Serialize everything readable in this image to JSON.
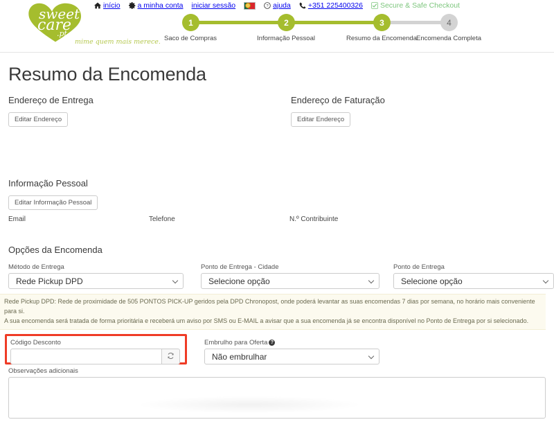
{
  "topbar": {
    "items": [
      {
        "label": "início",
        "icon": "home-icon"
      },
      {
        "label": "a minha conta",
        "icon": "gear-icon"
      },
      {
        "label": "iniciar sessão",
        "icon": "none"
      },
      {
        "label": "",
        "icon": "portugal-flag-icon"
      },
      {
        "label": "ajuda",
        "icon": "question-circle-icon"
      },
      {
        "label": "+351 225400326",
        "icon": "phone-icon"
      },
      {
        "label": "Secure & Safe Checkout",
        "icon": "check-square-icon"
      }
    ],
    "secure_color": "#7dc67d"
  },
  "logo": {
    "line1": "sweet",
    "line2": "care",
    "line3": ".pt",
    "tagline": "mime quem mais merece.",
    "heart_color": "#a5bd2e",
    "tagline_color": "#b5c84f"
  },
  "stepper": {
    "active_color": "#a5bd2e",
    "inactive_color": "#d3d3d3",
    "steps": [
      {
        "number": "1",
        "label": "Saco de Compras",
        "active": true
      },
      {
        "number": "2",
        "label": "Informação Pessoal",
        "active": true
      },
      {
        "number": "3",
        "label": "Resumo da Encomenda",
        "active": true
      },
      {
        "number": "4",
        "label": "Encomenda Completa",
        "active": false
      }
    ]
  },
  "page": {
    "title": "Resumo da Encomenda"
  },
  "shipping_address": {
    "heading": "Endereço de Entrega",
    "edit_label": "Editar Endereço"
  },
  "billing_address": {
    "heading": "Endereço de Faturação",
    "edit_label": "Editar Endereço"
  },
  "personal_info": {
    "heading": "Informação Pessoal",
    "edit_label": "Editar Informação Pessoal",
    "fields": [
      {
        "label": "Email",
        "value": ""
      },
      {
        "label": "Telefone",
        "value": ""
      },
      {
        "label": "N.º Contribuinte",
        "value": ""
      }
    ]
  },
  "order_options": {
    "heading": "Opções da Encomenda",
    "delivery_method": {
      "label": "Método de Entrega",
      "value": "Rede Pickup DPD"
    },
    "pickup_city": {
      "label": "Ponto de Entrega - Cidade",
      "value": "Selecione opção"
    },
    "pickup_point": {
      "label": "Ponto de Entrega",
      "value": "Selecione opção"
    },
    "alert": {
      "line1": "Rede Pickup DPD: Rede de proximidade de 505 PONTOS PICK-UP geridos pela DPD Chronopost, onde poderá levantar as suas encomendas 7 dias por semana, no horário mais conveniente para si.",
      "line2": "A sua encomenda será tratada de forma prioritária e receberá um aviso por SMS ou E-MAIL a avisar que a sua encomenda já se encontra disponível no Ponto de Entrega por si selecionado."
    },
    "discount_code": {
      "label": "Código Desconto",
      "value": "",
      "placeholder": "",
      "button_icon": "refresh-icon",
      "highlight_color": "#ef3b26"
    },
    "gift_wrap": {
      "label": "Embrulho para Oferta",
      "help_icon": "question-mark-icon",
      "value": "Não embrulhar"
    },
    "notes": {
      "label": "Observações adicionais",
      "value": "",
      "placeholder": ""
    }
  }
}
